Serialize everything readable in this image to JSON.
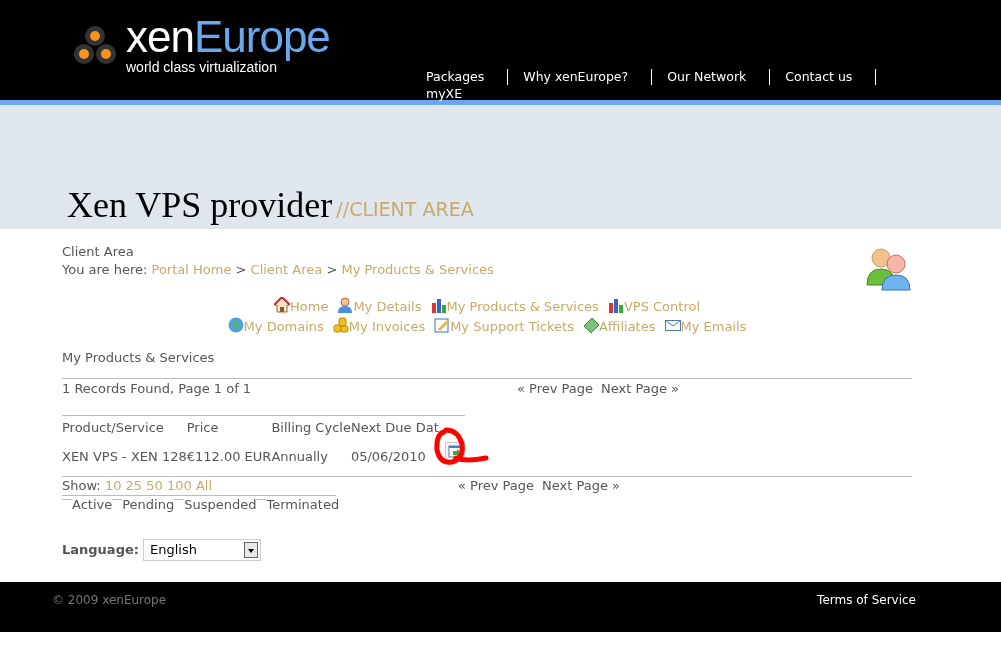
{
  "logo": {
    "name_first": "xen",
    "name_second": "Europe",
    "tagline": "world class virtualization"
  },
  "nav": [
    "Packages",
    "Why xenEurope?",
    "Our Network",
    "Contact us",
    "myXE"
  ],
  "banner": {
    "title": "Xen VPS provider",
    "subtitle": "//CLIENT AREA"
  },
  "page_label": "Client Area",
  "breadcrumb": {
    "prefix": "You are here:",
    "items": [
      "Portal Home",
      "Client Area",
      "My Products & Services"
    ],
    "separator": ">"
  },
  "menu_rows": [
    [
      "Home",
      "My Details",
      "My Products & Services",
      "VPS Control"
    ],
    [
      "My Domains",
      "My Invoices",
      "My Support Tickets",
      "Affiliates",
      "My Emails"
    ]
  ],
  "section_title": "My Products & Services",
  "records_text": "1 Records Found, Page 1 of 1",
  "pager_top": [
    "« Prev Page",
    "Next Page »"
  ],
  "table": {
    "columns": [
      "Product/Service",
      "Price",
      "Billing Cycle",
      "Next Due Dat"
    ],
    "rows": [
      {
        "cells": [
          "XEN VPS - XEN 128",
          "€112.00 EUR",
          "Annually",
          "05/06/2010"
        ]
      }
    ]
  },
  "show": {
    "label": "Show:",
    "options": [
      "10",
      "25",
      "50",
      "100",
      "All"
    ]
  },
  "pager_bottom": [
    "« Prev Page",
    "Next Page »"
  ],
  "legend": [
    "Active",
    "Pending",
    "Suspended",
    "Terminated"
  ],
  "language": {
    "label": "Language:",
    "value": "English"
  },
  "footer": {
    "copyright": "© 2009 xenEurope",
    "link": "Terms of Service"
  }
}
